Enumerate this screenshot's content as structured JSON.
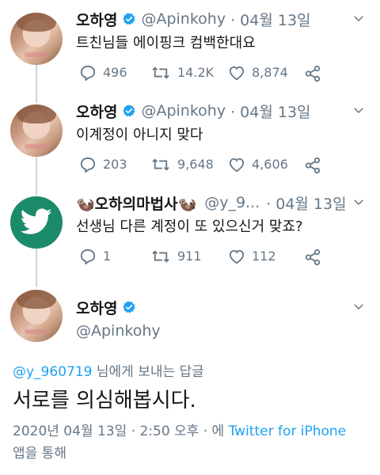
{
  "tweets": [
    {
      "name": "오하영",
      "handle": "@Apinkohy",
      "date": "· 04월 13일",
      "text": "트친님들 에이핑크 컴백한대요",
      "replies": "496",
      "retweets": "14.2K",
      "likes": "8,874",
      "verified": true
    },
    {
      "name": "오하영",
      "handle": "@Apinkohy",
      "date": "· 04월 13일",
      "text": "이계정이 아니지 맞다",
      "replies": "203",
      "retweets": "9,648",
      "likes": "4,606",
      "verified": true
    },
    {
      "name": "🦦오하의마법사🦦",
      "handle": "@y_9...",
      "date": "· 04월 13일",
      "text": "선생님 다른 계정이 또 있으신거 맞죠?",
      "replies": "1",
      "retweets": "911",
      "likes": "112",
      "verified": false
    }
  ],
  "main_tweet": {
    "name": "오하영",
    "handle": "@Apinkohy",
    "reply_to_mention": "@y_960719",
    "reply_to_suffix": " 님에게 보내는 답글",
    "text": "서로를 의심해봅시다.",
    "timestamp": "2020년 04월 13일 · 2:50 오후 · 에 ",
    "source": "Twitter for iPhone",
    "source_suffix": "앱을 통해"
  },
  "colors": {
    "verified_blue": "#1da1f2",
    "secondary_text": "#657786",
    "primary_text": "#14171a",
    "thread_line": "#ccd6dd"
  },
  "icons": [
    "verified-badge-icon",
    "chevron-down-icon",
    "reply-icon",
    "retweet-icon",
    "like-icon",
    "share-icon",
    "twitter-bird-icon"
  ]
}
